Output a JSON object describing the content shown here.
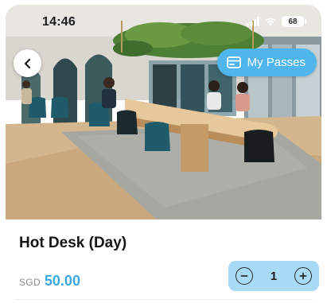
{
  "status_bar": {
    "time": "14:46",
    "battery": "68"
  },
  "hero": {
    "description_icons": [
      "signal-icon",
      "wifi-icon",
      "battery-icon"
    ]
  },
  "nav": {
    "back_icon": "chevron-left-icon",
    "passes_label": "My Passes",
    "passes_icon": "pass-card-icon"
  },
  "product": {
    "title": "Hot Desk (Day)",
    "currency": "SGD",
    "price": "50.00",
    "quantity": "1"
  },
  "colors": {
    "accent": "#4fb5ec",
    "price": "#3aa7e4",
    "stepper_bg": "#a9daf6"
  }
}
